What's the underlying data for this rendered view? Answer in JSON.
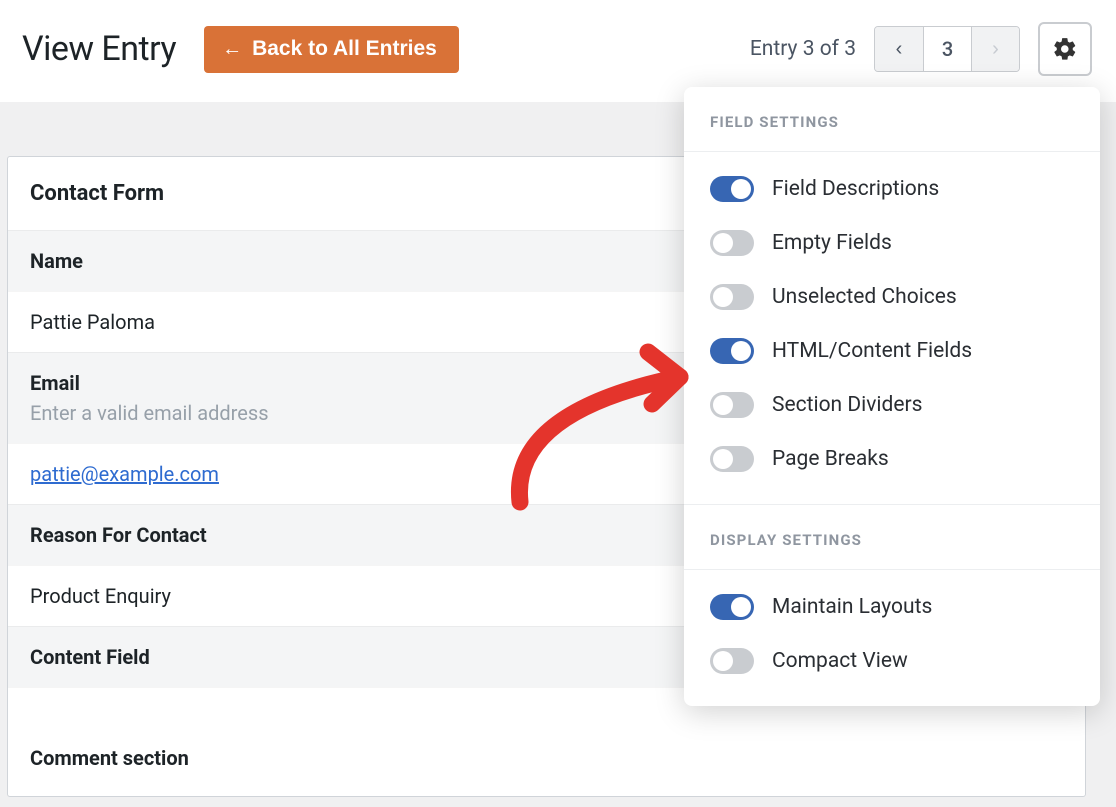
{
  "header": {
    "title": "View Entry",
    "back_label": "Back to All Entries",
    "counter": "Entry 3 of 3",
    "pager_number": "3"
  },
  "form": {
    "title": "Contact Form",
    "name_header": "Name",
    "name_value": "Pattie Paloma",
    "email_header": "Email",
    "email_desc": "Enter a valid email address",
    "email_value": "pattie@example.com",
    "reason_header": "Reason For Contact",
    "reason_value": "Product Enquiry",
    "content_header": "Content Field",
    "comment_header": "Comment section"
  },
  "settings": {
    "field_title": "FIELD SETTINGS",
    "display_title": "DISPLAY SETTINGS",
    "field_descriptions": "Field Descriptions",
    "empty_fields": "Empty Fields",
    "unselected_choices": "Unselected Choices",
    "html_content_fields": "HTML/Content Fields",
    "section_dividers": "Section Dividers",
    "page_breaks": "Page Breaks",
    "maintain_layouts": "Maintain Layouts",
    "compact_view": "Compact View"
  }
}
